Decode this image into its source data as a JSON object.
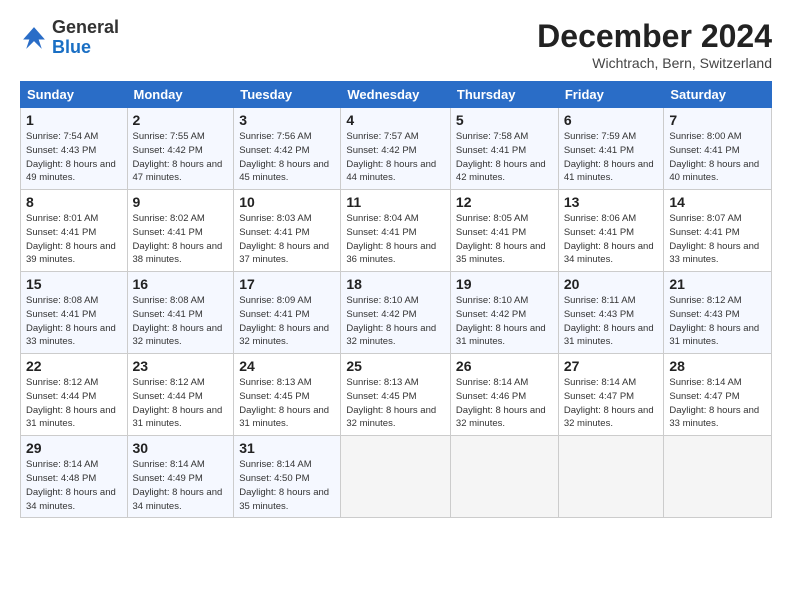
{
  "header": {
    "logo_line1": "General",
    "logo_line2": "Blue",
    "month_title": "December 2024",
    "location": "Wichtrach, Bern, Switzerland"
  },
  "days_of_week": [
    "Sunday",
    "Monday",
    "Tuesday",
    "Wednesday",
    "Thursday",
    "Friday",
    "Saturday"
  ],
  "weeks": [
    [
      {
        "day": "1",
        "rise": "7:54 AM",
        "set": "4:43 PM",
        "daylight": "8 hours and 49 minutes."
      },
      {
        "day": "2",
        "rise": "7:55 AM",
        "set": "4:42 PM",
        "daylight": "8 hours and 47 minutes."
      },
      {
        "day": "3",
        "rise": "7:56 AM",
        "set": "4:42 PM",
        "daylight": "8 hours and 45 minutes."
      },
      {
        "day": "4",
        "rise": "7:57 AM",
        "set": "4:42 PM",
        "daylight": "8 hours and 44 minutes."
      },
      {
        "day": "5",
        "rise": "7:58 AM",
        "set": "4:41 PM",
        "daylight": "8 hours and 42 minutes."
      },
      {
        "day": "6",
        "rise": "7:59 AM",
        "set": "4:41 PM",
        "daylight": "8 hours and 41 minutes."
      },
      {
        "day": "7",
        "rise": "8:00 AM",
        "set": "4:41 PM",
        "daylight": "8 hours and 40 minutes."
      }
    ],
    [
      {
        "day": "8",
        "rise": "8:01 AM",
        "set": "4:41 PM",
        "daylight": "8 hours and 39 minutes."
      },
      {
        "day": "9",
        "rise": "8:02 AM",
        "set": "4:41 PM",
        "daylight": "8 hours and 38 minutes."
      },
      {
        "day": "10",
        "rise": "8:03 AM",
        "set": "4:41 PM",
        "daylight": "8 hours and 37 minutes."
      },
      {
        "day": "11",
        "rise": "8:04 AM",
        "set": "4:41 PM",
        "daylight": "8 hours and 36 minutes."
      },
      {
        "day": "12",
        "rise": "8:05 AM",
        "set": "4:41 PM",
        "daylight": "8 hours and 35 minutes."
      },
      {
        "day": "13",
        "rise": "8:06 AM",
        "set": "4:41 PM",
        "daylight": "8 hours and 34 minutes."
      },
      {
        "day": "14",
        "rise": "8:07 AM",
        "set": "4:41 PM",
        "daylight": "8 hours and 33 minutes."
      }
    ],
    [
      {
        "day": "15",
        "rise": "8:08 AM",
        "set": "4:41 PM",
        "daylight": "8 hours and 33 minutes."
      },
      {
        "day": "16",
        "rise": "8:08 AM",
        "set": "4:41 PM",
        "daylight": "8 hours and 32 minutes."
      },
      {
        "day": "17",
        "rise": "8:09 AM",
        "set": "4:41 PM",
        "daylight": "8 hours and 32 minutes."
      },
      {
        "day": "18",
        "rise": "8:10 AM",
        "set": "4:42 PM",
        "daylight": "8 hours and 32 minutes."
      },
      {
        "day": "19",
        "rise": "8:10 AM",
        "set": "4:42 PM",
        "daylight": "8 hours and 31 minutes."
      },
      {
        "day": "20",
        "rise": "8:11 AM",
        "set": "4:43 PM",
        "daylight": "8 hours and 31 minutes."
      },
      {
        "day": "21",
        "rise": "8:12 AM",
        "set": "4:43 PM",
        "daylight": "8 hours and 31 minutes."
      }
    ],
    [
      {
        "day": "22",
        "rise": "8:12 AM",
        "set": "4:44 PM",
        "daylight": "8 hours and 31 minutes."
      },
      {
        "day": "23",
        "rise": "8:12 AM",
        "set": "4:44 PM",
        "daylight": "8 hours and 31 minutes."
      },
      {
        "day": "24",
        "rise": "8:13 AM",
        "set": "4:45 PM",
        "daylight": "8 hours and 31 minutes."
      },
      {
        "day": "25",
        "rise": "8:13 AM",
        "set": "4:45 PM",
        "daylight": "8 hours and 32 minutes."
      },
      {
        "day": "26",
        "rise": "8:14 AM",
        "set": "4:46 PM",
        "daylight": "8 hours and 32 minutes."
      },
      {
        "day": "27",
        "rise": "8:14 AM",
        "set": "4:47 PM",
        "daylight": "8 hours and 32 minutes."
      },
      {
        "day": "28",
        "rise": "8:14 AM",
        "set": "4:47 PM",
        "daylight": "8 hours and 33 minutes."
      }
    ],
    [
      {
        "day": "29",
        "rise": "8:14 AM",
        "set": "4:48 PM",
        "daylight": "8 hours and 34 minutes."
      },
      {
        "day": "30",
        "rise": "8:14 AM",
        "set": "4:49 PM",
        "daylight": "8 hours and 34 minutes."
      },
      {
        "day": "31",
        "rise": "8:14 AM",
        "set": "4:50 PM",
        "daylight": "8 hours and 35 minutes."
      },
      null,
      null,
      null,
      null
    ]
  ]
}
